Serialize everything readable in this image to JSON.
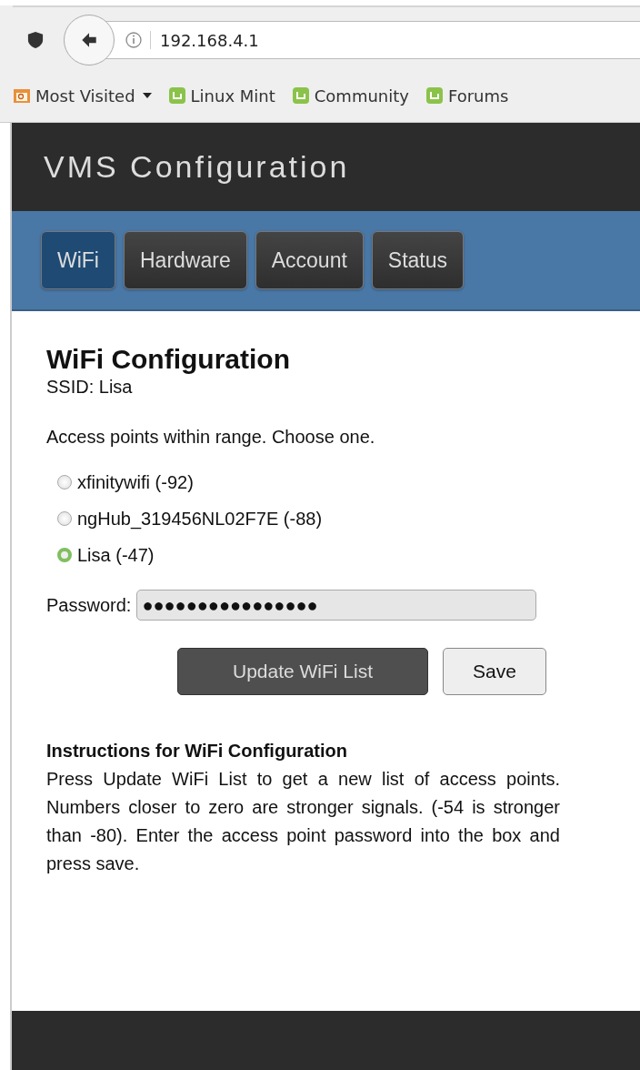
{
  "browser": {
    "url": "192.168.4.1",
    "bookmarks": [
      {
        "label": "Most Visited",
        "kind": "folder"
      },
      {
        "label": "Linux Mint",
        "kind": "site"
      },
      {
        "label": "Community",
        "kind": "site"
      },
      {
        "label": "Forums",
        "kind": "site"
      }
    ]
  },
  "header": {
    "title": "VMS Configuration"
  },
  "tabs": [
    {
      "label": "WiFi",
      "selected": true
    },
    {
      "label": "Hardware",
      "selected": false
    },
    {
      "label": "Account",
      "selected": false
    },
    {
      "label": "Status",
      "selected": false
    }
  ],
  "heading": "WiFi Configuration",
  "ssid": "SSID: Lisa",
  "prompt": "Access points within range. Choose one.",
  "access_points": [
    {
      "label": "xfinitywifi (-92)",
      "selected": false
    },
    {
      "label": "ngHub_319456NL02F7E (-88)",
      "selected": false
    },
    {
      "label": "Lisa (-47)",
      "selected": true
    }
  ],
  "password": {
    "label": "Password:",
    "value": "●●●●●●●●●●●●●●●●"
  },
  "buttons": [
    {
      "label": "Update WiFi List",
      "kind": "dark"
    },
    {
      "label": "Save",
      "kind": "light"
    }
  ],
  "instructions": {
    "title": "Instructions for WiFi Configuration",
    "text": "Press Update WiFi List to get a new list of access points. Numbers closer to zero are stronger signals. (-54 is stronger than -80). Enter the access point password into the box and press save."
  }
}
